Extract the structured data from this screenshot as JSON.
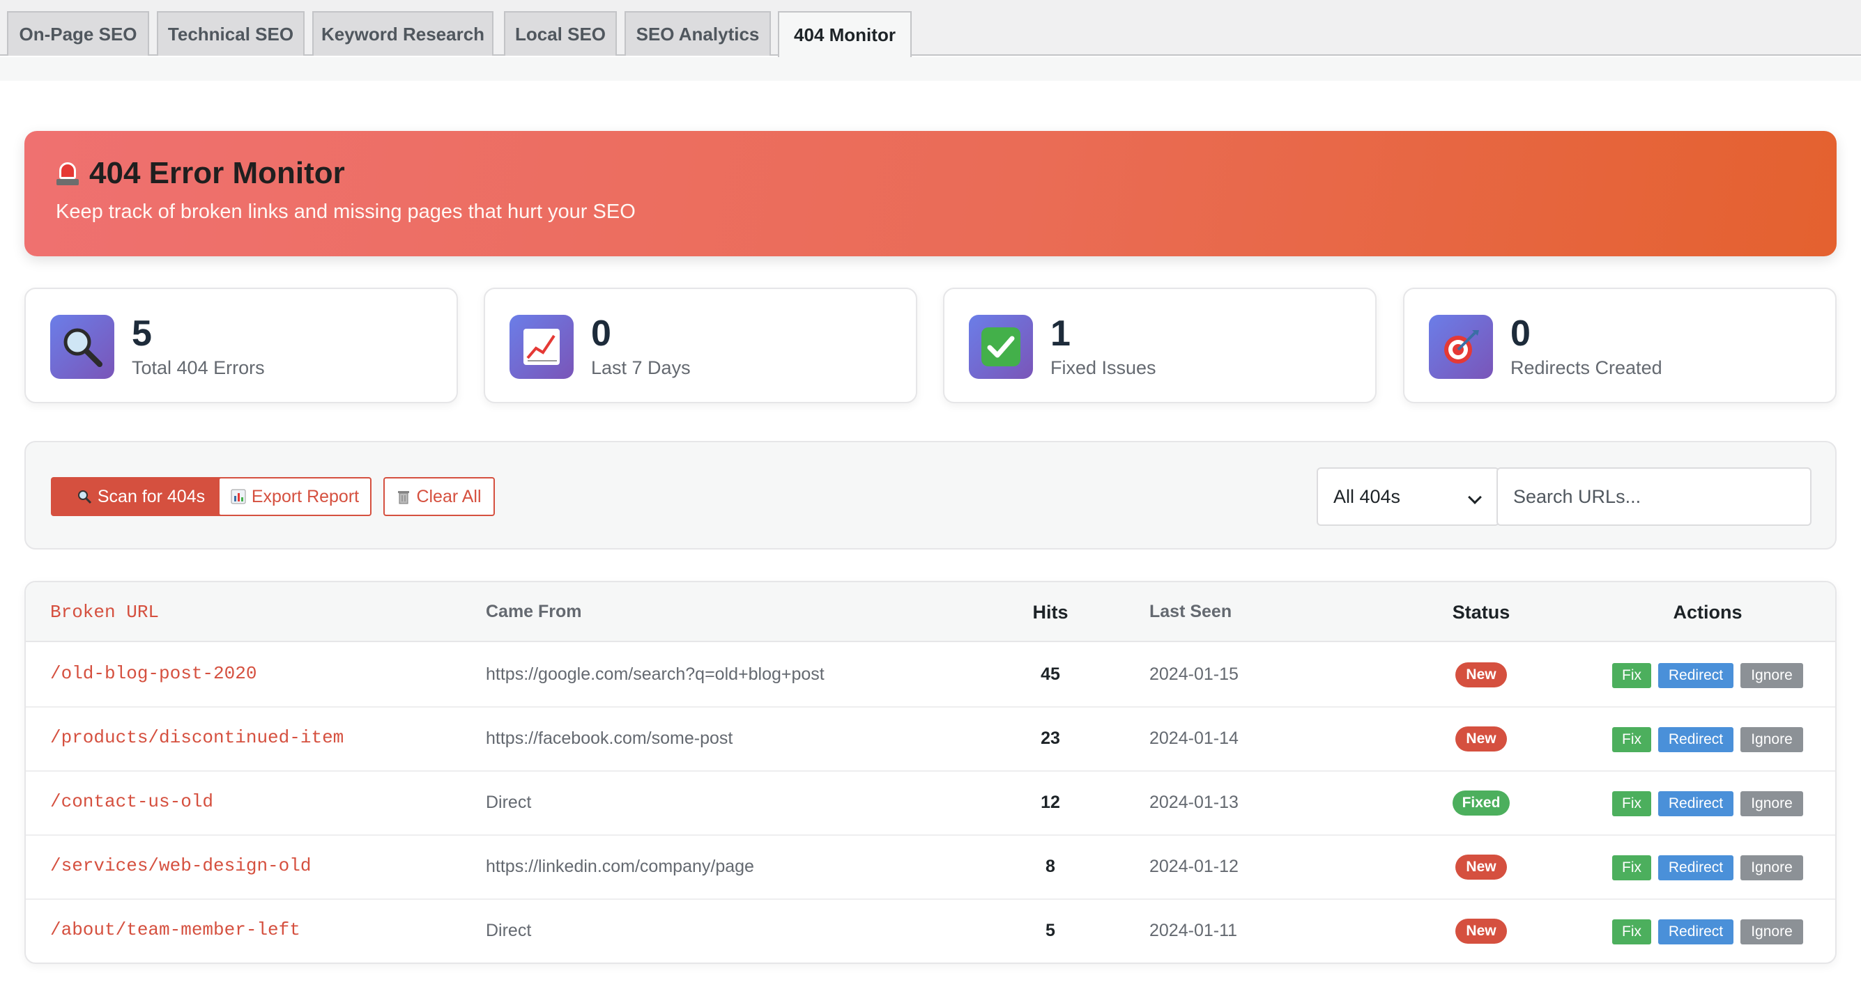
{
  "tabs": [
    {
      "label": "On-Page SEO"
    },
    {
      "label": "Technical SEO"
    },
    {
      "label": "Keyword Research"
    },
    {
      "label": "Local SEO"
    },
    {
      "label": "SEO Analytics"
    },
    {
      "label": "404 Monitor",
      "active": true
    }
  ],
  "hero": {
    "icon": "siren-icon",
    "title": "404 Error Monitor",
    "subtitle": "Keep track of broken links and missing pages that hurt your SEO"
  },
  "stats": [
    {
      "icon": "magnifier-icon",
      "value": "5",
      "label": "Total 404 Errors"
    },
    {
      "icon": "chart-up-icon",
      "value": "0",
      "label": "Last 7 Days"
    },
    {
      "icon": "check-icon",
      "value": "1",
      "label": "Fixed Issues"
    },
    {
      "icon": "target-icon",
      "value": "0",
      "label": "Redirects Created"
    }
  ],
  "toolbar": {
    "scan_label": "Scan for 404s",
    "export_label": "Export Report",
    "clear_label": "Clear All",
    "filter_value": "All 404s",
    "search_placeholder": "Search URLs..."
  },
  "table": {
    "headers": {
      "url": "Broken URL",
      "from": "Came From",
      "hits": "Hits",
      "seen": "Last Seen",
      "status": "Status",
      "actions": "Actions"
    },
    "rows": [
      {
        "url": "/old-blog-post-2020",
        "from": "https://google.com/search?q=old+blog+post",
        "hits": "45",
        "seen": "2024-01-15",
        "status": "New"
      },
      {
        "url": "/products/discontinued-item",
        "from": "https://facebook.com/some-post",
        "hits": "23",
        "seen": "2024-01-14",
        "status": "New"
      },
      {
        "url": "/contact-us-old",
        "from": "Direct",
        "hits": "12",
        "seen": "2024-01-13",
        "status": "Fixed"
      },
      {
        "url": "/services/web-design-old",
        "from": "https://linkedin.com/company/page",
        "hits": "8",
        "seen": "2024-01-12",
        "status": "New"
      },
      {
        "url": "/about/team-member-left",
        "from": "Direct",
        "hits": "5",
        "seen": "2024-01-11",
        "status": "New"
      }
    ],
    "action_labels": {
      "fix": "Fix",
      "redirect": "Redirect",
      "ignore": "Ignore"
    }
  },
  "colors": {
    "accent": "#d5503f",
    "hero_start": "#ef7170",
    "hero_end": "#e4612f",
    "success": "#4caf5d",
    "info": "#4a90d9",
    "muted": "#8c9196"
  }
}
